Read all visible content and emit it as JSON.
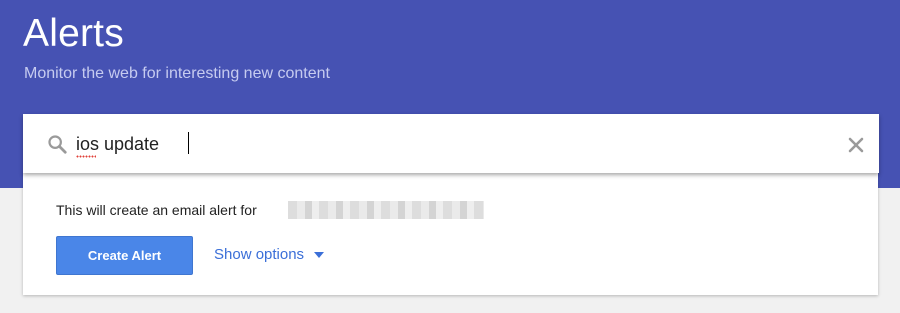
{
  "header": {
    "title": "Alerts",
    "subtitle": "Monitor the web for interesting new content",
    "background": "#4652b3"
  },
  "search": {
    "value": "ios update",
    "icon": "search-icon",
    "clear_icon": "close-icon"
  },
  "card": {
    "info_text": "This will create an email alert for",
    "create_label": "Create Alert",
    "show_options_label": "Show options",
    "button_color": "#4a86e8",
    "link_color": "#3b6fd8"
  }
}
